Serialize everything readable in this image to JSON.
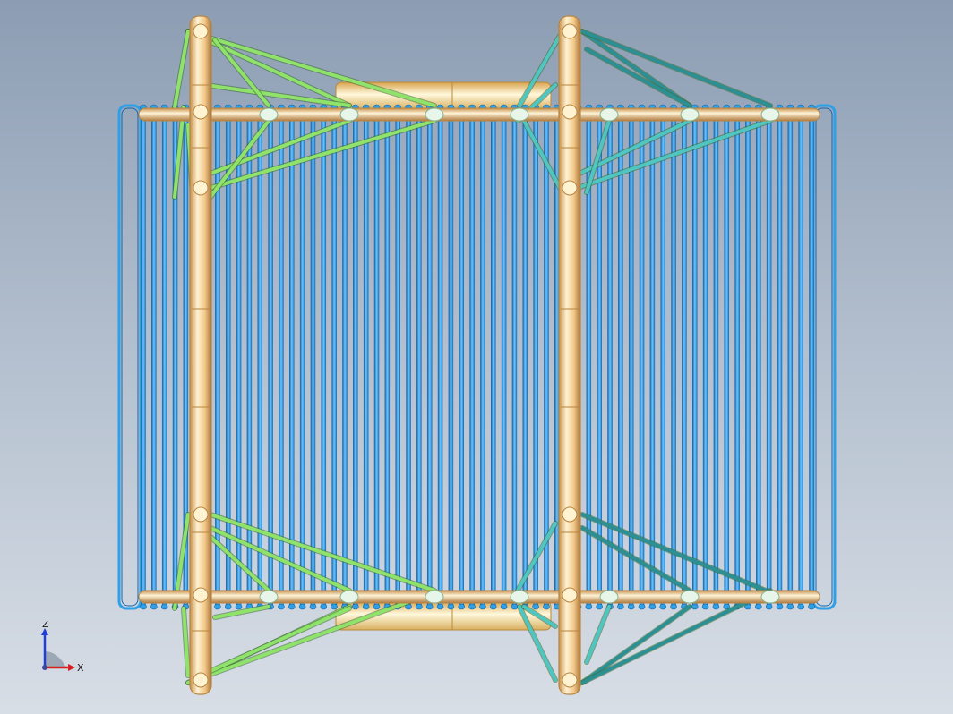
{
  "viewport": {
    "background_top": "#8c9db3",
    "background_bottom": "#d8dee6"
  },
  "model": {
    "bar_count": 64,
    "bar_color": "#2f9fe6",
    "bar_edge_color": "#1565a8",
    "frame_color": "#f7d9a0",
    "frame_edge_color": "#b88540",
    "hub_color": "#f3df9a",
    "left_strut_color": "#8fe26a",
    "right_strut_color": "#4fc6c2",
    "right_strut_dark_color": "#2b8f93"
  },
  "triad": {
    "z_label": "Z",
    "x_label": "X",
    "z_color": "#1f3fd6",
    "x_color": "#d62020"
  }
}
